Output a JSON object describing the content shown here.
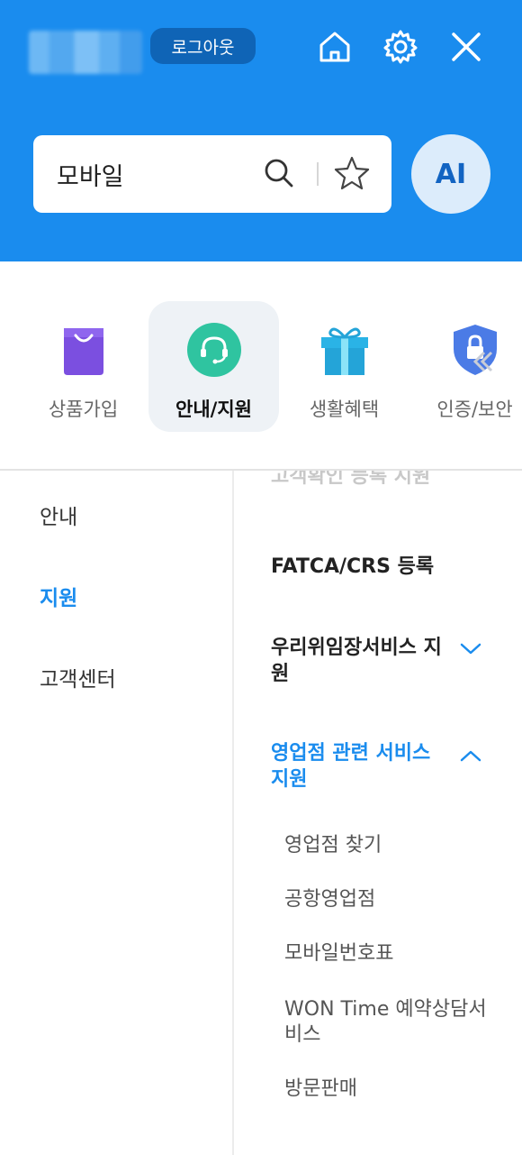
{
  "header": {
    "logout_label": "로그아웃",
    "home_icon": "home-icon",
    "settings_icon": "gear-icon",
    "close_icon": "close-icon",
    "bg_color": "#1a8cee"
  },
  "search": {
    "value": "모바일",
    "search_icon": "search-icon",
    "favorite_icon": "star-icon"
  },
  "ai_button": {
    "label": "AI"
  },
  "categories": [
    {
      "label": "상품가입",
      "icon": "shopping-bag-icon"
    },
    {
      "label": "안내/지원",
      "icon": "headset-icon",
      "active": true
    },
    {
      "label": "생활혜택",
      "icon": "gift-icon"
    },
    {
      "label": "인증/보안",
      "icon": "shield-lock-icon"
    }
  ],
  "left_menu": [
    {
      "label": "안내"
    },
    {
      "label": "지원",
      "active": true
    },
    {
      "label": "고객센터"
    }
  ],
  "right_menu": {
    "faded_item": "고객확인 등록 지원",
    "items": [
      {
        "label": "FATCA/CRS 등록"
      },
      {
        "label": "우리위임장서비스 지원",
        "state": "collapsed"
      },
      {
        "label": "영업점 관련 서비스 지원",
        "state": "expanded"
      }
    ],
    "sub_items": [
      {
        "label": "영업점 찾기"
      },
      {
        "label": "공항영업점"
      },
      {
        "label": "모바일번호표"
      },
      {
        "label": "WON Time 예약상담서비스"
      },
      {
        "label": "방문판매"
      }
    ]
  },
  "colors": {
    "accent": "#1a8cee",
    "logout_bg": "#0f64b6",
    "ai_bg": "#dcecfb"
  }
}
